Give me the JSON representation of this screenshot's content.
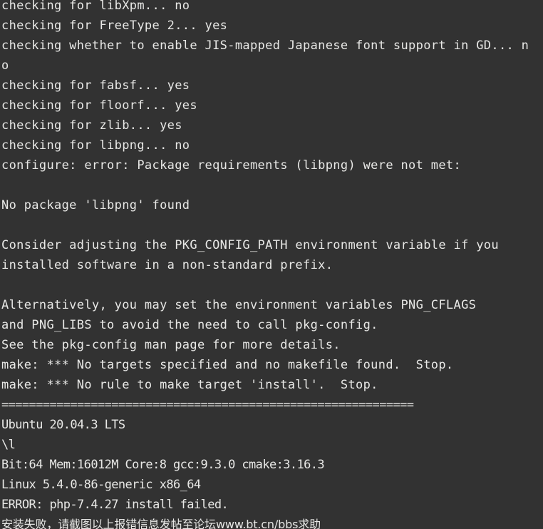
{
  "terminal": {
    "window_title": "Terminal",
    "colors": {
      "background": "#323232",
      "foreground": "#e8e8e6"
    },
    "columns": 70,
    "lines": [
      {
        "id": "line-1",
        "text": "checking for libXpm... no",
        "style": "normal",
        "clipped_top": true
      },
      {
        "id": "line-2",
        "text": "checking for FreeType 2... yes",
        "style": "normal"
      },
      {
        "id": "line-3",
        "text": "checking whether to enable JIS-mapped Japanese font support in GD... n",
        "style": "normal"
      },
      {
        "id": "line-4",
        "text": "o",
        "style": "normal"
      },
      {
        "id": "line-5",
        "text": "checking for fabsf... yes",
        "style": "normal"
      },
      {
        "id": "line-6",
        "text": "checking for floorf... yes",
        "style": "normal"
      },
      {
        "id": "line-7",
        "text": "checking for zlib... yes",
        "style": "normal"
      },
      {
        "id": "line-8",
        "text": "checking for libpng... no",
        "style": "normal"
      },
      {
        "id": "line-9",
        "text": "configure: error: Package requirements (libpng) were not met:",
        "style": "normal"
      },
      {
        "id": "line-10",
        "text": "",
        "style": "blank"
      },
      {
        "id": "line-11",
        "text": "No package 'libpng' found",
        "style": "normal"
      },
      {
        "id": "line-12",
        "text": "",
        "style": "blank"
      },
      {
        "id": "line-13",
        "text": "Consider adjusting the PKG_CONFIG_PATH environment variable if you",
        "style": "normal"
      },
      {
        "id": "line-14",
        "text": "installed software in a non-standard prefix.",
        "style": "normal"
      },
      {
        "id": "line-15",
        "text": "",
        "style": "blank"
      },
      {
        "id": "line-16",
        "text": "Alternatively, you may set the environment variables PNG_CFLAGS",
        "style": "normal"
      },
      {
        "id": "line-17",
        "text": "and PNG_LIBS to avoid the need to call pkg-config.",
        "style": "normal"
      },
      {
        "id": "line-18",
        "text": "See the pkg-config man page for more details.",
        "style": "normal"
      },
      {
        "id": "line-19",
        "text": "make: *** No targets specified and no makefile found.  Stop.",
        "style": "normal"
      },
      {
        "id": "line-20",
        "text": "make: *** No rule to make target 'install'.  Stop.",
        "style": "normal"
      },
      {
        "id": "line-21",
        "text": "============================================================",
        "style": "compact"
      },
      {
        "id": "line-22",
        "text": "Ubuntu 20.04.3 LTS",
        "style": "compact"
      },
      {
        "id": "line-23",
        "text": "\\l",
        "style": "compact"
      },
      {
        "id": "line-24",
        "text": "Bit:64 Mem:16012M Core:8 gcc:9.3.0 cmake:3.16.3",
        "style": "compact"
      },
      {
        "id": "line-25",
        "text": "Linux 5.4.0-86-generic x86_64",
        "style": "compact"
      },
      {
        "id": "line-26",
        "text": "ERROR: php-7.4.27 install failed.",
        "style": "compact"
      },
      {
        "id": "line-27",
        "text": "安装失败，请截图以上报错信息发帖至论坛www.bt.cn/bbs求助",
        "style": "cn"
      }
    ]
  }
}
